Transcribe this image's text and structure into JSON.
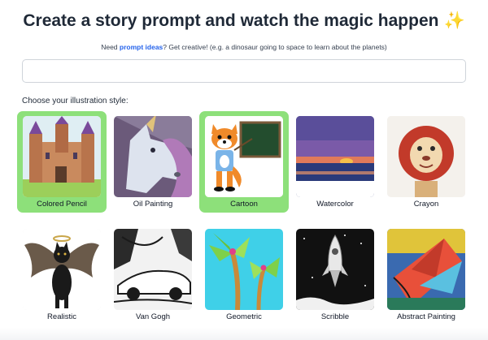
{
  "header": {
    "title": "Create a story prompt and watch the magic happen",
    "sparkle": "✨"
  },
  "subtitle": {
    "prefix": "Need ",
    "link": "prompt ideas",
    "suffix": "? Get creative! (e.g. a dinosaur going to space to learn about the planets)"
  },
  "prompt_input": {
    "value": "",
    "placeholder": ""
  },
  "styles_label": "Choose your illustration style:",
  "styles": [
    {
      "label": "Colored Pencil",
      "selected": true,
      "icon": "castle-image"
    },
    {
      "label": "Oil Painting",
      "selected": false,
      "icon": "unicorn-image"
    },
    {
      "label": "Cartoon",
      "selected": true,
      "icon": "fox-teacher-image"
    },
    {
      "label": "Watercolor",
      "selected": false,
      "icon": "sunset-image"
    },
    {
      "label": "Crayon",
      "selected": false,
      "icon": "lion-image"
    },
    {
      "label": "Realistic",
      "selected": false,
      "icon": "winged-cat-image"
    },
    {
      "label": "Van Gogh",
      "selected": false,
      "icon": "sports-car-image"
    },
    {
      "label": "Geometric",
      "selected": false,
      "icon": "palm-trees-image"
    },
    {
      "label": "Scribble",
      "selected": false,
      "icon": "rocket-image"
    },
    {
      "label": "Abstract Painting",
      "selected": false,
      "icon": "abstract-kite-image"
    }
  ],
  "colors": {
    "selected": "#8de07a",
    "link": "#2563eb",
    "title": "#1f2937"
  }
}
